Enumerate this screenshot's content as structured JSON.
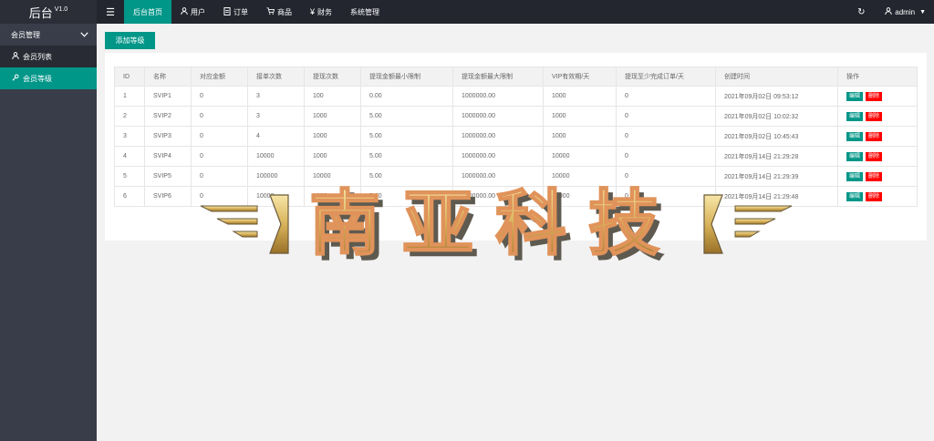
{
  "logo": {
    "name": "后台",
    "version": "V1.0"
  },
  "nav": [
    {
      "label": "后台首页",
      "icon": "",
      "active": true
    },
    {
      "label": "用户",
      "icon": "user-icon"
    },
    {
      "label": "订单",
      "icon": "document-icon"
    },
    {
      "label": "商品",
      "icon": "cart-icon"
    },
    {
      "label": "财务",
      "icon": "yen-icon"
    },
    {
      "label": "系统管理",
      "icon": ""
    }
  ],
  "topbar": {
    "username": "admin"
  },
  "sidebar": {
    "group_label": "会员管理",
    "items": [
      {
        "label": "会员列表",
        "icon": "user-icon",
        "active": false
      },
      {
        "label": "会员等级",
        "icon": "key-icon",
        "active": true
      }
    ]
  },
  "main": {
    "add_button": "添加等级",
    "table": {
      "headers": [
        "ID",
        "名称",
        "对应金额",
        "接单次数",
        "提现次数",
        "提现金额最小限制",
        "提现金额最大限制",
        "VIP有效期/天",
        "提现至少完成订单/天",
        "创建时间",
        "操作"
      ],
      "rows": [
        [
          "1",
          "SVIP1",
          "0",
          "3",
          "100",
          "0.00",
          "1000000.00",
          "1000",
          "0",
          "2021年09月02日 09:53:12"
        ],
        [
          "2",
          "SVIP2",
          "0",
          "3",
          "1000",
          "5.00",
          "1000000.00",
          "1000",
          "0",
          "2021年09月02日 10:02:32"
        ],
        [
          "3",
          "SVIP3",
          "0",
          "4",
          "1000",
          "5.00",
          "1000000.00",
          "1000",
          "0",
          "2021年09月02日 10:45:43"
        ],
        [
          "4",
          "SVIP4",
          "0",
          "10000",
          "1000",
          "5.00",
          "1000000.00",
          "10000",
          "0",
          "2021年09月14日 21:29:28"
        ],
        [
          "5",
          "SVIP5",
          "0",
          "100000",
          "10000",
          "5.00",
          "1000000.00",
          "10000",
          "0",
          "2021年09月14日 21:29:39"
        ],
        [
          "6",
          "SVIP6",
          "0",
          "10000",
          "1000",
          "5.00",
          "1000000.00",
          "10000",
          "0",
          "2021年09月14日 21:29:48"
        ]
      ],
      "edit_label": "编辑",
      "delete_label": "删除"
    }
  },
  "watermark": {
    "text": "南亚科技"
  },
  "colors": {
    "accent": "#009688",
    "topbar": "#23262e",
    "sidebar": "#393d49",
    "danger": "#ff0000"
  }
}
